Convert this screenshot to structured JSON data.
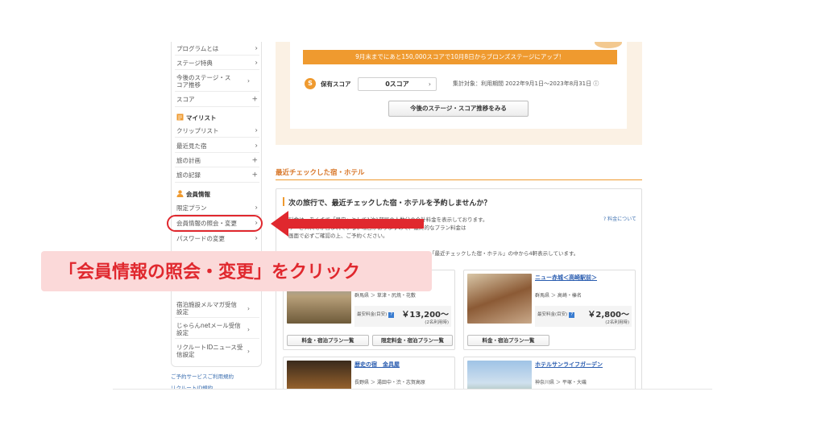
{
  "sidebar": {
    "items": [
      {
        "label": "プログラムとは",
        "icon": "chevron-right"
      },
      {
        "label": "ステージ特典",
        "icon": "chevron-right"
      },
      {
        "label": "今後のステージ・スコア推移",
        "icon": "chevron-right"
      },
      {
        "label": "スコア",
        "icon": "plus"
      }
    ],
    "mylist_heading": "マイリスト",
    "mylist_items": [
      {
        "label": "クリップリスト",
        "icon": "chevron-right"
      },
      {
        "label": "最近見た宿",
        "icon": "chevron-right"
      },
      {
        "label": "旅の計画",
        "icon": "plus"
      },
      {
        "label": "旅の記録",
        "icon": "plus"
      }
    ],
    "member_heading": "会員情報",
    "member_items": [
      {
        "label": "限定プラン",
        "icon": "chevron-right"
      },
      {
        "label": "会員情報の照会・変更",
        "icon": "chevron-right"
      },
      {
        "label": "パスワードの変更",
        "icon": "chevron-right"
      },
      {
        "label": "宿泊施設メルマガ受信設定",
        "icon": "chevron-right"
      },
      {
        "label": "じゃらんnetメール受信設定",
        "icon": "chevron-right"
      },
      {
        "label": "リクルートIDニュース受信設定",
        "icon": "chevron-right"
      }
    ],
    "footer_links": [
      "ご予約サービスご利用規約",
      "リクルートID規約"
    ]
  },
  "stage": {
    "banner": "9月末までにあと150,000スコアで10月8日からブロンズステージにアップ！",
    "score_badge": "S",
    "score_label": "保有スコア",
    "score_value": "0スコア",
    "period": "集計対象：利用期間  2022年9月1日〜2023年8月31日 ⓘ",
    "button": "今後のステージ・スコア推移をみる"
  },
  "recent": {
    "section_title": "最近チェックした宿・ホテル",
    "question": "次の旅行で、最近チェックした宿・ホテルを予約しませんか？",
    "note_lines": [
      "料金は、あくまで「目安」として1泊1部屋の人数分の合計料金を表示しております。",
      "サービス料等が含まれていない場合がありますので、最終的なプラン料金は",
      "画面で必ずご確認の上、ご予約ください。",
      "「最近チェックした宿・ホテル」の中から4軒表示しています。"
    ],
    "help_link": "? 料金について",
    "hotels": [
      {
        "name": "",
        "location": "群馬県 ＞ 草津・尻焼・花敷",
        "price_label": "最安料金(目安)",
        "price": "￥13,200〜",
        "price_note": "(2名利用時)",
        "buttons": [
          "料金・宿泊プラン一覧",
          "限定料金・宿泊プラン一覧"
        ]
      },
      {
        "name": "ニュー赤城＜高崎駅前＞",
        "location": "群馬県 ＞ 高崎・榛名",
        "price_label": "最安料金(目安)",
        "price": "￥2,800〜",
        "price_note": "(2名利用時)",
        "buttons": [
          "料金・宿泊プラン一覧"
        ]
      },
      {
        "name": "歴史の宿　金具屋",
        "location": "長野県 ＞ 湯田中・渋・志賀高原",
        "buttons": []
      },
      {
        "name": "ホテルサンライフガーデン",
        "location": "神奈川県 ＞ 平塚・大磯",
        "buttons": []
      }
    ]
  },
  "callout": {
    "text": "「会員情報の照会・変更」をクリック"
  },
  "colors": {
    "accent_orange": "#ef9a2f",
    "highlight_red": "#e0282e",
    "callout_bg": "#fbd9d9",
    "link_blue": "#2a5db0"
  }
}
